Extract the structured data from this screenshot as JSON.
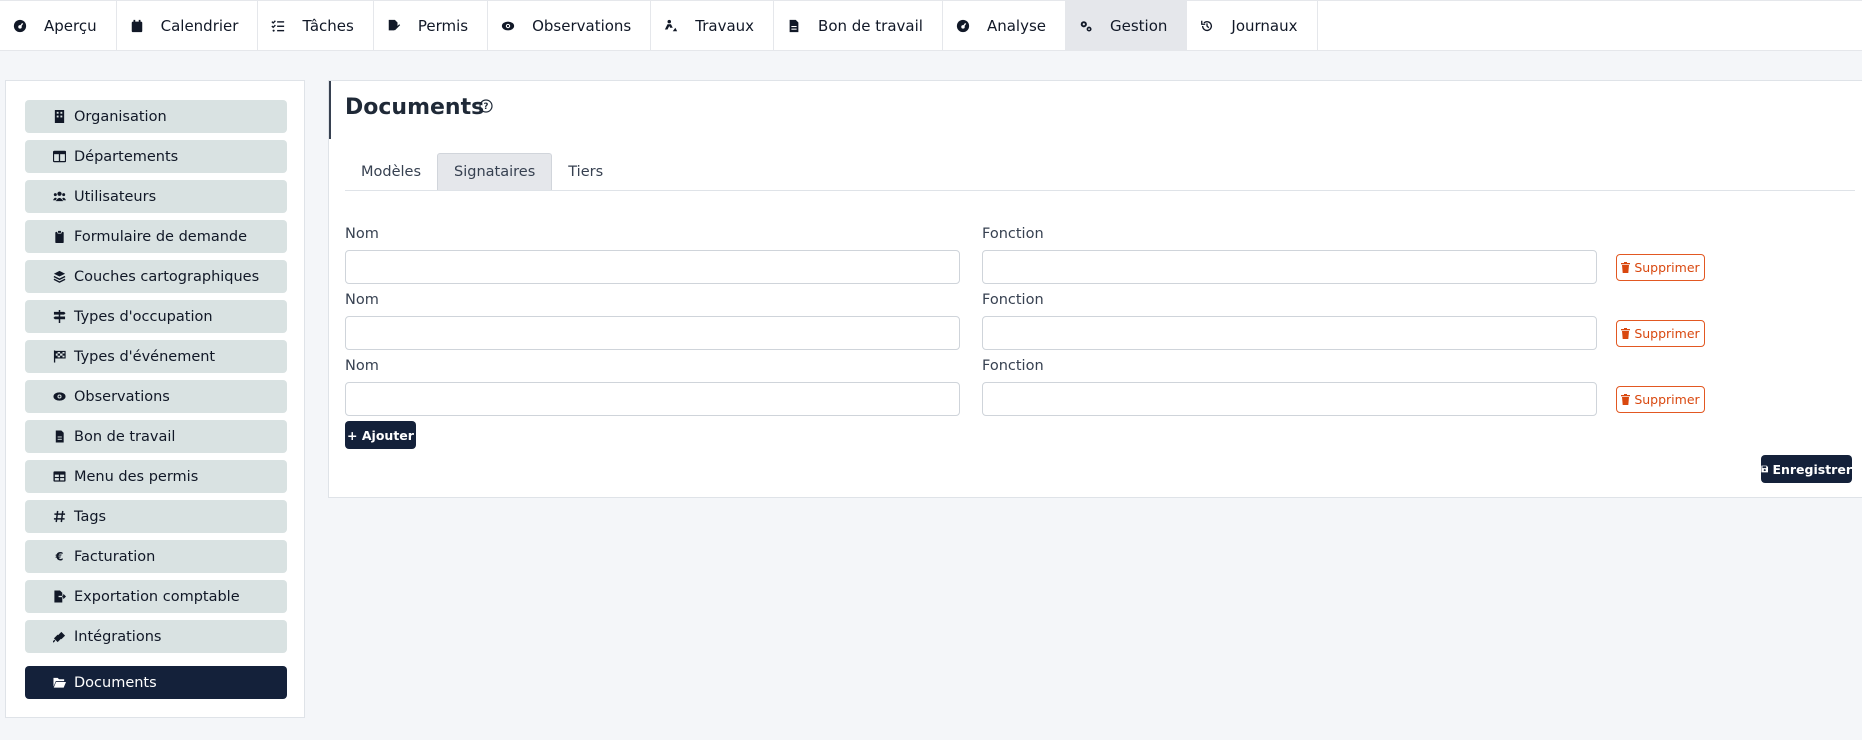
{
  "nav": {
    "items": [
      {
        "label": "Aperçu",
        "icon": "gauge-icon"
      },
      {
        "label": "Calendrier",
        "icon": "calendar-icon"
      },
      {
        "label": "Tâches",
        "icon": "checklist-icon"
      },
      {
        "label": "Permis",
        "icon": "file-signature-icon"
      },
      {
        "label": "Observations",
        "icon": "eye-icon"
      },
      {
        "label": "Travaux",
        "icon": "digging-icon"
      },
      {
        "label": "Bon de travail",
        "icon": "file-icon"
      },
      {
        "label": "Analyse",
        "icon": "gauge-icon"
      },
      {
        "label": "Gestion",
        "icon": "gears-icon"
      },
      {
        "label": "Journaux",
        "icon": "history-icon"
      }
    ],
    "active": "Gestion"
  },
  "sidebar": {
    "items": [
      {
        "label": "Organisation",
        "icon": "building-icon"
      },
      {
        "label": "Départements",
        "icon": "table-columns-icon"
      },
      {
        "label": "Utilisateurs",
        "icon": "users-icon"
      },
      {
        "label": "Formulaire de demande",
        "icon": "clipboard-icon"
      },
      {
        "label": "Couches cartographiques",
        "icon": "layers-icon"
      },
      {
        "label": "Types d'occupation",
        "icon": "signs-post-icon"
      },
      {
        "label": "Types d'événement",
        "icon": "flag-checkered-icon"
      },
      {
        "label": "Observations",
        "icon": "eye-icon"
      },
      {
        "label": "Bon de travail",
        "icon": "file-icon"
      },
      {
        "label": "Menu des permis",
        "icon": "table-icon"
      },
      {
        "label": "Tags",
        "icon": "hashtag-icon"
      },
      {
        "label": "Facturation",
        "icon": "euro-icon"
      },
      {
        "label": "Exportation comptable",
        "icon": "file-export-icon"
      },
      {
        "label": "Intégrations",
        "icon": "plug-icon"
      },
      {
        "label": "Documents",
        "icon": "folder-open-icon"
      }
    ],
    "active": "Documents"
  },
  "main": {
    "title": "Documents",
    "help_icon": "question-circle-icon",
    "tabs": [
      {
        "label": "Modèles"
      },
      {
        "label": "Signataires"
      },
      {
        "label": "Tiers"
      }
    ],
    "active_tab": "Signataires",
    "signatories": [
      {
        "name_label": "Nom",
        "name_value": "",
        "function_label": "Fonction",
        "function_value": "",
        "delete_label": "Supprimer"
      },
      {
        "name_label": "Nom",
        "name_value": "",
        "function_label": "Fonction",
        "function_value": "",
        "delete_label": "Supprimer"
      },
      {
        "name_label": "Nom",
        "name_value": "",
        "function_label": "Fonction",
        "function_value": "",
        "delete_label": "Supprimer"
      }
    ],
    "add_label": "+ Ajouter",
    "save_label": "Enregistrer"
  },
  "colors": {
    "primary_dark": "#14213a",
    "sidebar_item_bg": "#d9e2e2",
    "danger": "#d9480f",
    "page_bg": "#f4f6f9"
  }
}
